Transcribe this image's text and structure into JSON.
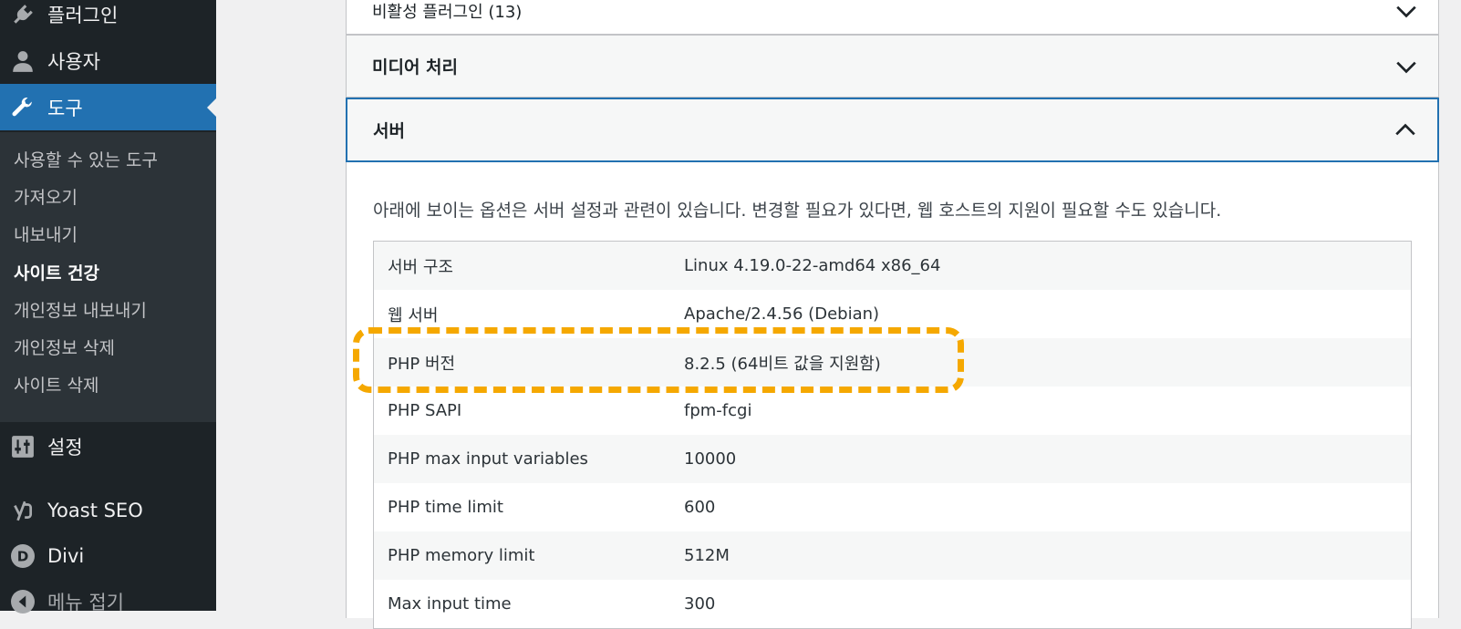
{
  "sidebar": {
    "items": [
      {
        "label": "플러그인",
        "icon": "plugin-icon"
      },
      {
        "label": "사용자",
        "icon": "user-icon"
      },
      {
        "label": "도구",
        "icon": "wrench-icon",
        "active": true
      },
      {
        "label": "설정",
        "icon": "settings-sliders-icon"
      },
      {
        "label": "Yoast SEO",
        "icon": "yoast-icon"
      },
      {
        "label": "Divi",
        "icon": "divi-icon"
      },
      {
        "label": "메뉴 접기",
        "icon": "collapse-arrow-icon"
      }
    ],
    "submenu": [
      "사용할 수 있는 도구",
      "가져오기",
      "내보내기",
      "사이트 건강",
      "개인정보 내보내기",
      "개인정보 삭제",
      "사이트 삭제"
    ],
    "current_submenu": "사이트 건강"
  },
  "accordion": {
    "inactive_plugins": "비활성 플러그인 (13)",
    "media": "미디어 처리",
    "server": "서버"
  },
  "server": {
    "description": "아래에 보이는 옵션은 서버 설정과 관련이 있습니다. 변경할 필요가 있다면, 웹 호스트의 지원이 필요할 수도 있습니다.",
    "rows": [
      {
        "key": "서버 구조",
        "value": "Linux 4.19.0-22-amd64 x86_64"
      },
      {
        "key": "웹 서버",
        "value": "Apache/2.4.56 (Debian)"
      },
      {
        "key": "PHP 버전",
        "value": "8.2.5 (64비트 값을 지원함)"
      },
      {
        "key": "PHP SAPI",
        "value": "fpm-fcgi"
      },
      {
        "key": "PHP max input variables",
        "value": "10000"
      },
      {
        "key": "PHP time limit",
        "value": "600"
      },
      {
        "key": "PHP memory limit",
        "value": "512M"
      },
      {
        "key": "Max input time",
        "value": "300"
      }
    ]
  },
  "colors": {
    "sidebar_bg": "#1d2327",
    "submenu_bg": "#2c3338",
    "accent": "#2271b1",
    "highlight": "#f5a800"
  }
}
